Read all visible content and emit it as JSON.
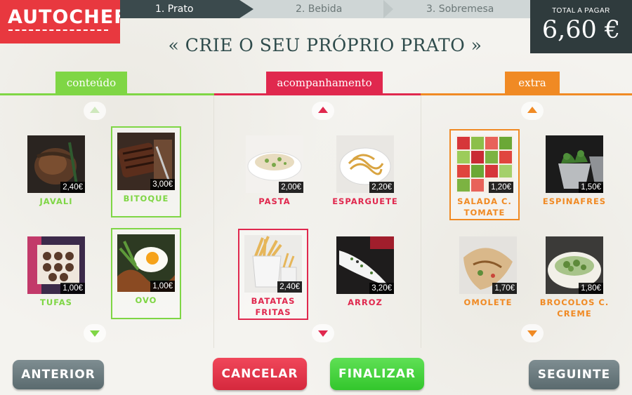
{
  "app": {
    "logo": "AUTOCHEF"
  },
  "steps": [
    {
      "label": "1.  Prato",
      "active": true
    },
    {
      "label": "2.  Bebida",
      "active": false
    },
    {
      "label": "3.  Sobremesa",
      "active": false
    }
  ],
  "total": {
    "label": "TOTAL A PAGAR",
    "value": "6,60 €"
  },
  "title": "« CRIE O SEU PRÓPRIO PRATO »",
  "columns": [
    {
      "label": "conteúdo",
      "color": "#7fd645",
      "items": [
        {
          "name": "JAVALI",
          "price": "2,40€",
          "selected": false,
          "image": "grilled-meat"
        },
        {
          "name": "BITOQUE",
          "price": "3,00€",
          "selected": true,
          "image": "steak"
        },
        {
          "name": "TUFAS",
          "price": "1,00€",
          "selected": false,
          "image": "truffles"
        },
        {
          "name": "OVO",
          "price": "1,00€",
          "selected": true,
          "image": "fried-egg"
        }
      ]
    },
    {
      "label": "acompanhamento",
      "color": "#e0284e",
      "items": [
        {
          "name": "PASTA",
          "price": "2,00€",
          "selected": false,
          "image": "pasta"
        },
        {
          "name": "ESPARGUETE",
          "price": "2,20€",
          "selected": false,
          "image": "spaghetti"
        },
        {
          "name": "BATATAS FRITAS",
          "price": "2,40€",
          "selected": true,
          "image": "fries"
        },
        {
          "name": "ARROZ",
          "price": "3,20€",
          "selected": false,
          "image": "rice"
        }
      ]
    },
    {
      "label": "extra",
      "color": "#f08a24",
      "items": [
        {
          "name": "SALADA C. TOMATE",
          "price": "1,20€",
          "selected": true,
          "image": "tomato-salad"
        },
        {
          "name": "ESPINAFRES",
          "price": "1,50€",
          "selected": false,
          "image": "spinach"
        },
        {
          "name": "OMOLETE",
          "price": "1,70€",
          "selected": false,
          "image": "omelette"
        },
        {
          "name": "BROCOLOS C. CREME",
          "price": "1,80€",
          "selected": false,
          "image": "broccoli"
        }
      ]
    }
  ],
  "buttons": {
    "previous": "ANTERIOR",
    "cancel": "CANCELAR",
    "finish": "FINALIZAR",
    "next": "SEGUINTE"
  }
}
